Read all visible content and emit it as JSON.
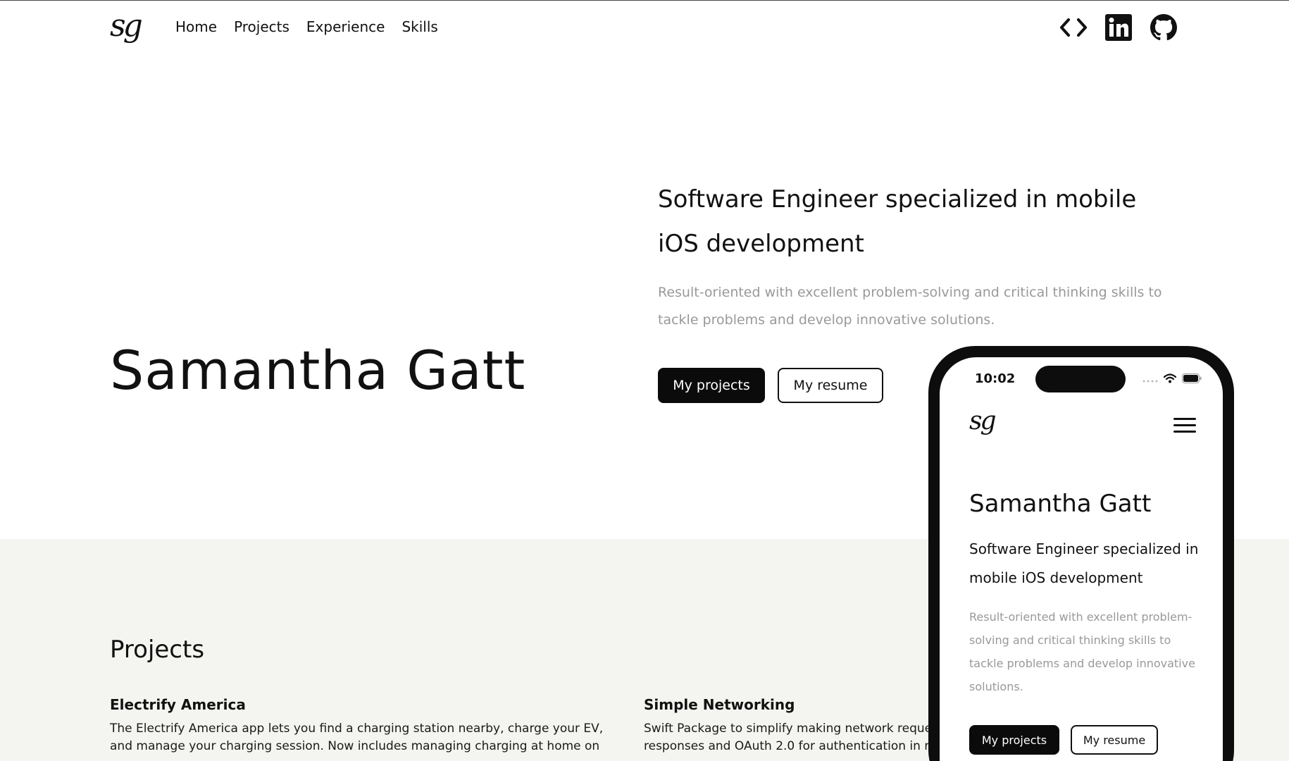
{
  "nav": {
    "logo_text": "sg",
    "links": [
      "Home",
      "Projects",
      "Experience",
      "Skills"
    ],
    "icons": [
      "code-icon",
      "linkedin-icon",
      "github-icon"
    ]
  },
  "hero": {
    "name": "Samantha Gatt",
    "title": "Software Engineer specialized in mobile iOS development",
    "description": "Result-oriented with excellent problem-solving and critical thinking skills to tackle problems and develop innovative solutions.",
    "primary_button": "My projects",
    "secondary_button": "My resume"
  },
  "projects": {
    "heading": "Projects",
    "items": [
      {
        "title": "Electrify America",
        "description": "The Electrify America app lets you find a charging station nearby, charge your EV, and manage your charging session. Now includes managing charging at home on"
      },
      {
        "title": "Simple Networking",
        "description": "Swift Package to simplify making network reque responses and OAuth 2.0 for authentication in m"
      }
    ]
  },
  "phone": {
    "time": "10:02",
    "logo_text": "sg",
    "name": "Samantha Gatt",
    "title": "Software Engineer specialized in mobile iOS development",
    "description": "Result-oriented with excellent problem-solving and critical thinking skills to tackle problems and develop innovative solutions.",
    "primary_button": "My projects",
    "secondary_button": "My resume"
  },
  "colors": {
    "background": "#ffffff",
    "band": "#f4f4f0",
    "accent": "#0b0b0b",
    "muted_text": "#999999"
  }
}
